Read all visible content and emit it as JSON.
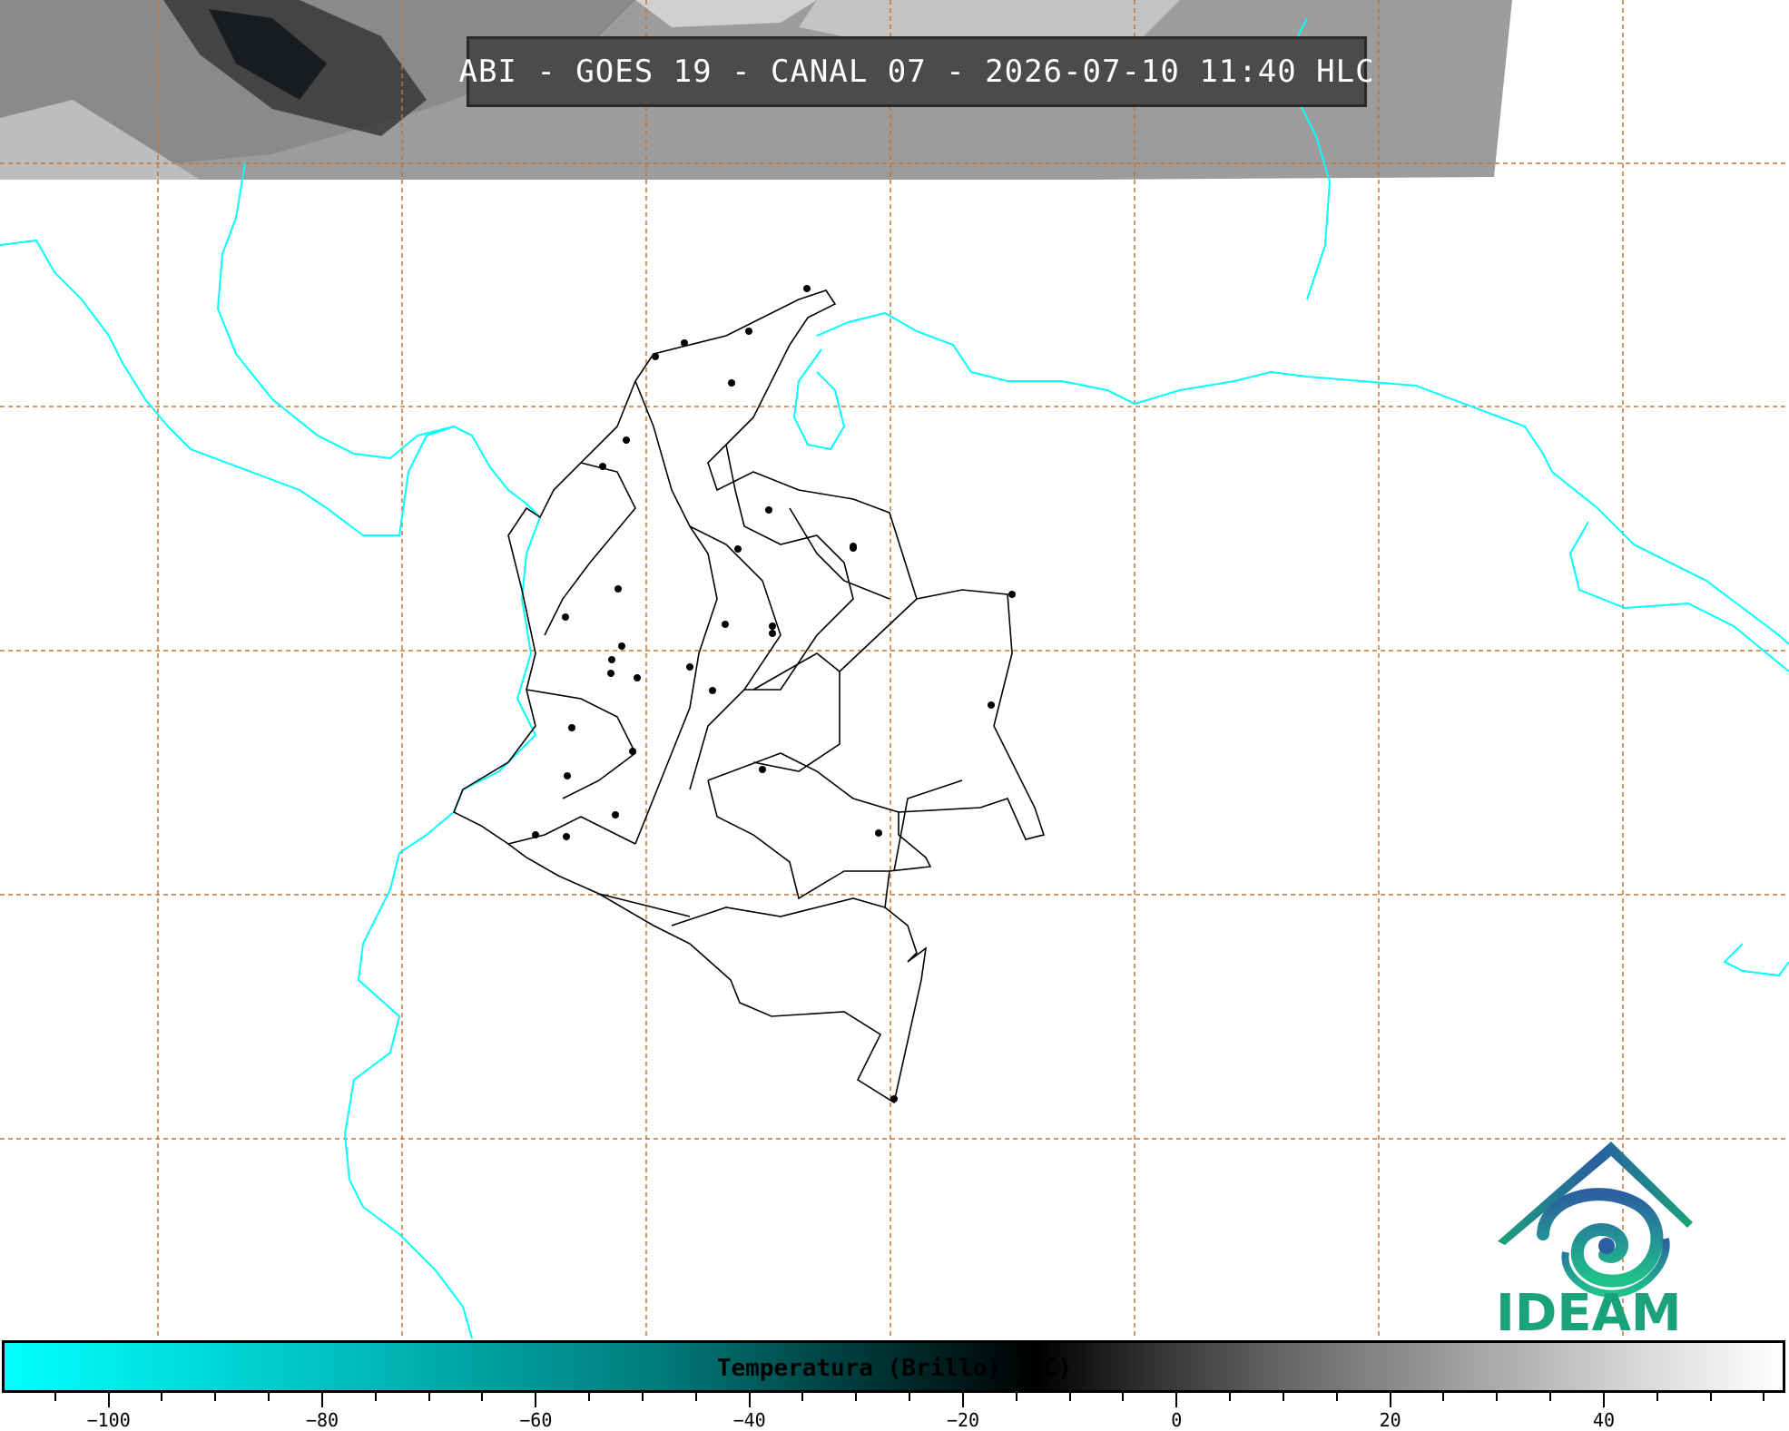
{
  "title": "ABI - GOES 19 - CANAL 07 - 2026-07-10 11:40 HLC",
  "colorbar": {
    "label": "Temperatura (Brillo) (°C)",
    "min": -110,
    "max": 57,
    "ticks": [
      -100,
      -80,
      -60,
      -40,
      -20,
      0,
      20,
      40
    ],
    "tick_labels": [
      "−100",
      "−80",
      "−60",
      "−40",
      "−20",
      "0",
      "20",
      "40"
    ],
    "colors": {
      "cold": "#00ffff",
      "mid": "#000000",
      "warm": "#ffffff"
    }
  },
  "logo": {
    "text": "IDEAM",
    "colors": {
      "roof": "#2a5fa0",
      "swirl": "#1aa37a"
    }
  },
  "map": {
    "coastline_color": "#00ffff",
    "borders_color": "#000000",
    "grid_color": "#c87533",
    "satellite_band_colors": [
      "#7a7a7a",
      "#9a9a9a",
      "#b0b0b0"
    ]
  }
}
